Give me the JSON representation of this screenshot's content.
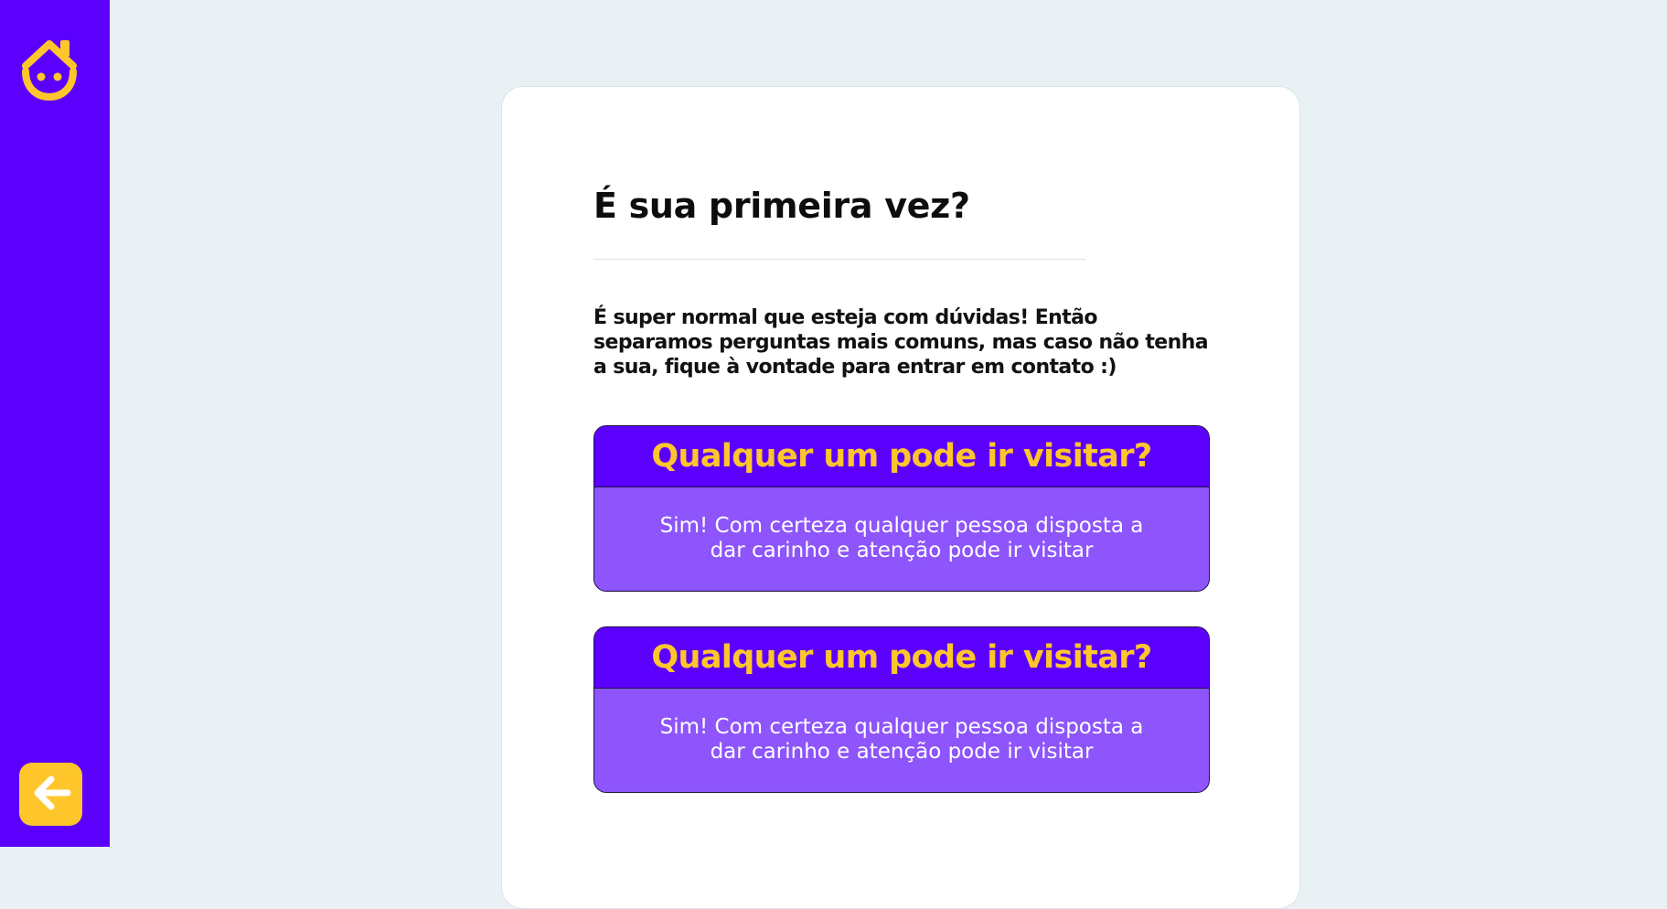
{
  "sidebar": {
    "logo_icon": "house-smiley-icon",
    "back_icon": "arrow-left-icon",
    "accent_color": "#ffc62c",
    "background_color": "#5c00fe"
  },
  "main": {
    "title": "É sua primeira vez?",
    "intro": "É super normal que esteja com dúvidas! Então separamos perguntas mais comuns, mas caso não tenha a sua, fique à vontade para entrar em contato :)",
    "faqs": [
      {
        "question": "Qualquer um pode ir visitar?",
        "answer": "Sim! Com certeza qualquer pessoa disposta a dar carinho e atenção pode ir visitar"
      },
      {
        "question": "Qualquer um pode ir visitar?",
        "answer": "Sim! Com certeza qualquer pessoa disposta a dar carinho e atenção pode ir visitar"
      }
    ]
  }
}
